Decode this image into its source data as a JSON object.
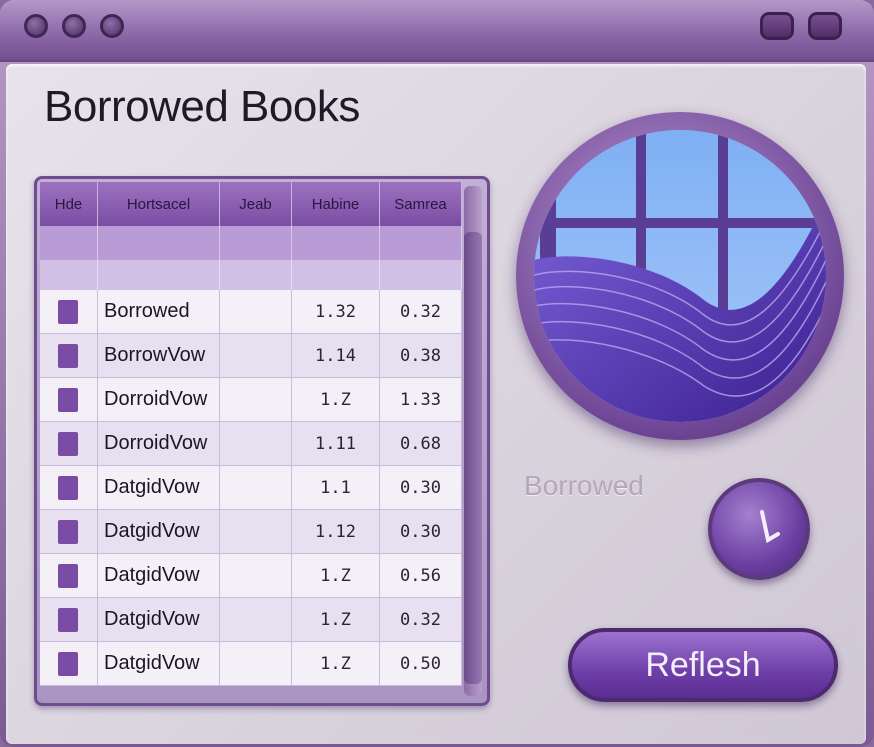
{
  "window": {
    "controls": [
      "close",
      "minimize",
      "maximize"
    ],
    "right_controls": [
      "minimize",
      "maximize"
    ]
  },
  "page_title": "Borrowed Books",
  "table": {
    "headers": [
      "Hde",
      "Hortsacel",
      "Jeab",
      "Habine",
      "Samrea"
    ],
    "rows": [
      {
        "title": "Borrowed",
        "col3": "1.32",
        "col4": "0.32"
      },
      {
        "title": "BorrowVow",
        "col3": "1.14",
        "col4": "0.38"
      },
      {
        "title": "DorroidVow",
        "col3": "1.Z",
        "col4": "1.33"
      },
      {
        "title": "DorroidVow",
        "col3": "1.11",
        "col4": "0.68"
      },
      {
        "title": "DatgidVow",
        "col3": "1.1",
        "col4": "0.30"
      },
      {
        "title": "DatgidVow",
        "col3": "1.12",
        "col4": "0.30"
      },
      {
        "title": "DatgidVow",
        "col3": "1.Z",
        "col4": "0.56"
      },
      {
        "title": "DatgidVow",
        "col3": "1.Z",
        "col4": "0.32"
      },
      {
        "title": "DatgidVow",
        "col3": "1.Z",
        "col4": "0.50"
      }
    ]
  },
  "status_label": "Borrowed",
  "refresh_label": "Reflesh",
  "colors": {
    "accent": "#7a4ca5",
    "sky": "#6ea0ee",
    "wave": "#5a3fb0"
  }
}
